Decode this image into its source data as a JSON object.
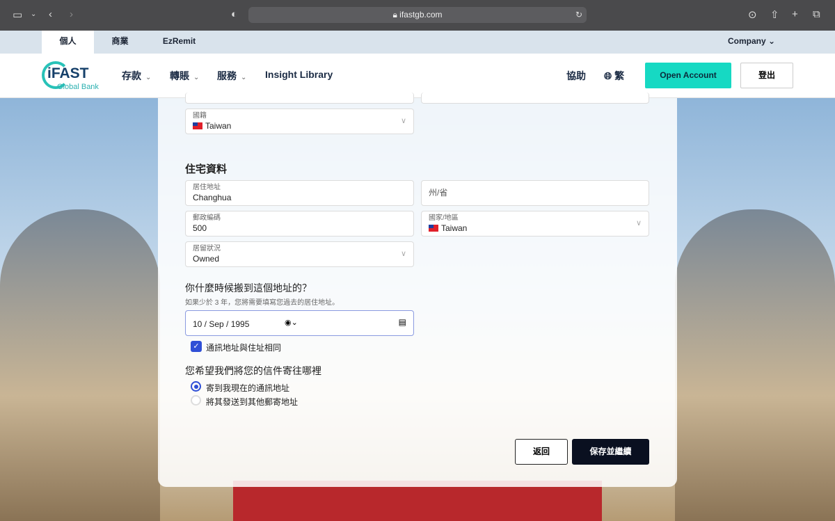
{
  "browser": {
    "url": "ifastgb.com"
  },
  "topbar": {
    "tabs": [
      "個人",
      "商業",
      "EzRemit"
    ],
    "company": "Company"
  },
  "nav": {
    "logo_main": "iFAST",
    "logo_sub": "Global Bank",
    "items": [
      "存款",
      "轉賬",
      "服務",
      "Insight Library"
    ],
    "help": "協助",
    "language": "繁",
    "open_account": "Open Account",
    "logout": "登出"
  },
  "form": {
    "nationality": {
      "label": "國籍",
      "value": "Taiwan"
    },
    "section_title": "住宅資料",
    "address": {
      "label": "居住地址",
      "value": "Changhua"
    },
    "state": {
      "placeholder": "州/省"
    },
    "postcode": {
      "label": "郵政編碼",
      "value": "500"
    },
    "country": {
      "label": "國家/地區",
      "value": "Taiwan"
    },
    "residency": {
      "label": "居留狀況",
      "value": "Owned"
    },
    "move_question": "你什麼時候搬到這個地址的？",
    "move_hint": "如果少於 3 年，您將需要填寫您過去的居住地址。",
    "move_date": "10 / Sep / 1995",
    "same_address": {
      "label": "通訊地址與住址相同",
      "checked": true
    },
    "mail_question": "您希望我們將您的信件寄往哪裡",
    "mail_options": [
      {
        "label": "寄到我現在的通訊地址",
        "selected": true
      },
      {
        "label": "將其發送到其他郵寄地址",
        "selected": false
      }
    ],
    "back": "返回",
    "save": "保存並繼續"
  },
  "colors": {
    "accent": "#16d9c3",
    "primary": "#2f4fd6",
    "dark": "#0a1020"
  }
}
